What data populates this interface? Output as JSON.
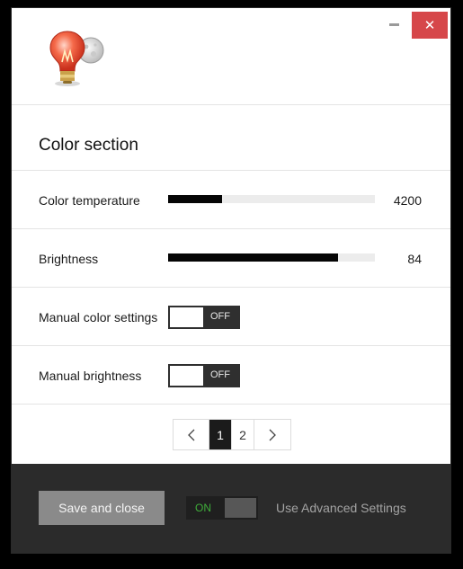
{
  "window": {
    "close_label": "✕"
  },
  "section": {
    "title": "Color section"
  },
  "settings": {
    "color_temperature": {
      "label": "Color temperature",
      "value": "4200",
      "fill_fraction": 0.26
    },
    "brightness": {
      "label": "Brightness",
      "value": "84",
      "fill_fraction": 0.82
    },
    "manual_color": {
      "label": "Manual color settings",
      "state": "OFF"
    },
    "manual_brightness": {
      "label": "Manual brightness",
      "state": "OFF"
    }
  },
  "pagination": {
    "pages": [
      "1",
      "2"
    ],
    "current": "1"
  },
  "footer": {
    "save_label": "Save and close",
    "advanced_toggle_state": "ON",
    "advanced_label": "Use Advanced Settings"
  },
  "colors": {
    "close_button": "#d6474a",
    "toggle_on_text": "#3fae3a",
    "footer_background": "#2b2b2b"
  },
  "icons": {
    "app": "lightbulb-moon-icon",
    "minimize": "minimize-icon",
    "close": "close-icon",
    "prev": "chevron-left-icon",
    "next": "chevron-right-icon"
  }
}
